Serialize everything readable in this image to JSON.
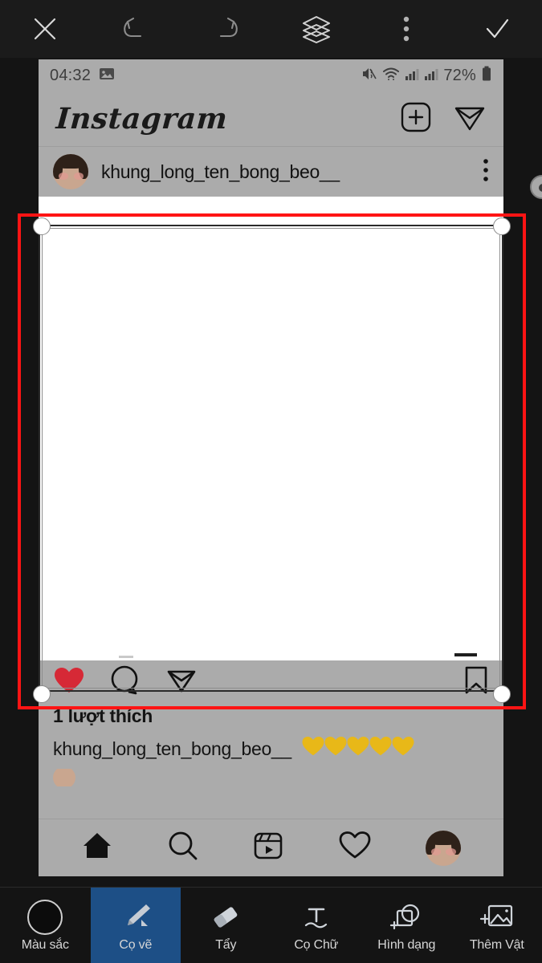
{
  "app": {
    "name": "photo-editor",
    "accent_blue": "#1d4f86",
    "selection_color": "#ff1414",
    "toolbar_bg": "#1b1b1b"
  },
  "top_toolbar": {
    "buttons": [
      {
        "name": "close",
        "icon": "close-x-icon"
      },
      {
        "name": "undo",
        "icon": "undo-arrow-icon"
      },
      {
        "name": "redo",
        "icon": "redo-arrow-icon"
      },
      {
        "name": "layers",
        "icon": "layers-stack-icon"
      },
      {
        "name": "more",
        "icon": "more-vertical-icon"
      },
      {
        "name": "confirm",
        "icon": "checkmark-icon"
      }
    ]
  },
  "canvas": {
    "screenshot": {
      "status_bar": {
        "time": "04:32",
        "left_icons": [
          "image-icon"
        ],
        "right_icons": [
          "mute-icon",
          "wifi-icon",
          "signal-icon",
          "signal-icon"
        ],
        "battery_percent": "72%"
      },
      "instagram": {
        "logo": "Instagram",
        "header_icons": [
          "add-post-icon",
          "direct-message-icon"
        ],
        "post": {
          "username": "khung_long_ten_bong_beo__",
          "more_icon": "more-vertical-icon",
          "actions": [
            "heart-filled-icon",
            "comment-icon",
            "share-icon",
            "bookmark-icon"
          ],
          "likes": "1 lượt thích",
          "caption_user": "khung_long_ten_bong_beo__",
          "caption_hearts": "💛💛💛💛💛",
          "heart_count": 5,
          "heart_color": "#e8b818",
          "liked_heart_color": "#d62936"
        },
        "bottom_nav": [
          {
            "name": "home",
            "icon": "home-icon",
            "active": true
          },
          {
            "name": "search",
            "icon": "search-icon",
            "active": false
          },
          {
            "name": "reels",
            "icon": "reels-icon",
            "active": false
          },
          {
            "name": "activity",
            "icon": "heart-outline-icon",
            "active": false
          },
          {
            "name": "profile",
            "icon": "profile-avatar-icon",
            "active": false
          }
        ]
      }
    },
    "selection": {
      "active": true,
      "handles": 4,
      "rotate_handle": true
    }
  },
  "bottom_toolbar": {
    "tools": [
      {
        "label": "Màu sắc",
        "icon": "color-swatch-icon",
        "active": false
      },
      {
        "label": "Cọ vẽ",
        "icon": "brush-icon",
        "active": true
      },
      {
        "label": "Tẩy",
        "icon": "eraser-icon",
        "active": false
      },
      {
        "label": "Cọ Chữ",
        "icon": "text-brush-icon",
        "active": false
      },
      {
        "label": "Hình dạng",
        "icon": "shape-icon",
        "active": false
      },
      {
        "label": "Thêm Vật",
        "icon": "add-image-icon",
        "active": false
      }
    ]
  }
}
